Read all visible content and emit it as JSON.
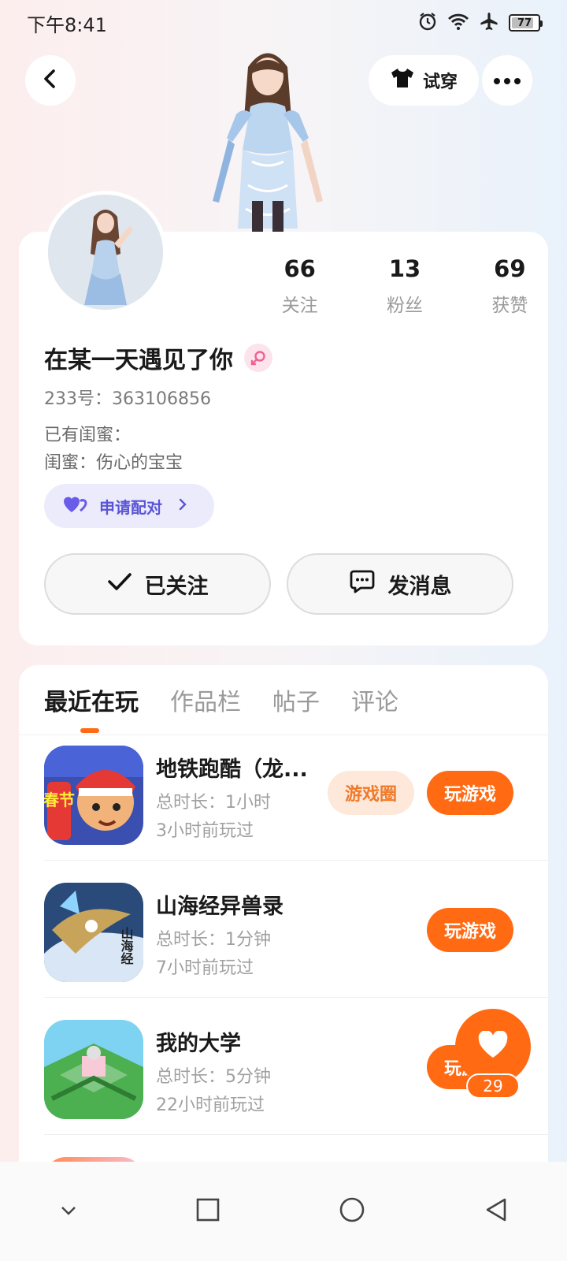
{
  "status_bar": {
    "time": "下午8:41",
    "battery": "77"
  },
  "header": {
    "try_on_label": "试穿"
  },
  "profile": {
    "stats": [
      {
        "value": "66",
        "label": "关注"
      },
      {
        "value": "13",
        "label": "粉丝"
      },
      {
        "value": "69",
        "label": "获赞"
      }
    ],
    "nickname": "在某一天遇见了你",
    "uid": "233号：363106856",
    "bestie_label": "已有闺蜜：",
    "bestie_name": "闺蜜：伤心的宝宝",
    "pair_button": "申请配对",
    "follow_button": "已关注",
    "message_button": "发消息"
  },
  "tabs": [
    {
      "label": "最近在玩",
      "active": true
    },
    {
      "label": "作品栏"
    },
    {
      "label": "帖子"
    },
    {
      "label": "评论"
    }
  ],
  "games": [
    {
      "title": "地铁跑酷（龙...",
      "duration": "总时长：1小时",
      "last_played": "3小时前玩过",
      "circle_label": "游戏圈",
      "play_label": "玩游戏",
      "icon_label": "春节"
    },
    {
      "title": "山海经异兽录",
      "duration": "总时长：1分钟",
      "last_played": "7小时前玩过",
      "play_label": "玩游戏",
      "icon_label": "山海经"
    },
    {
      "title": "我的大学",
      "duration": "总时长：5分钟",
      "last_played": "22小时前玩过",
      "play_label": "玩游戏"
    }
  ],
  "like_fab": {
    "count": "29"
  },
  "colors": {
    "accent": "#ff6a13",
    "pair_purple": "#5a55d6"
  }
}
